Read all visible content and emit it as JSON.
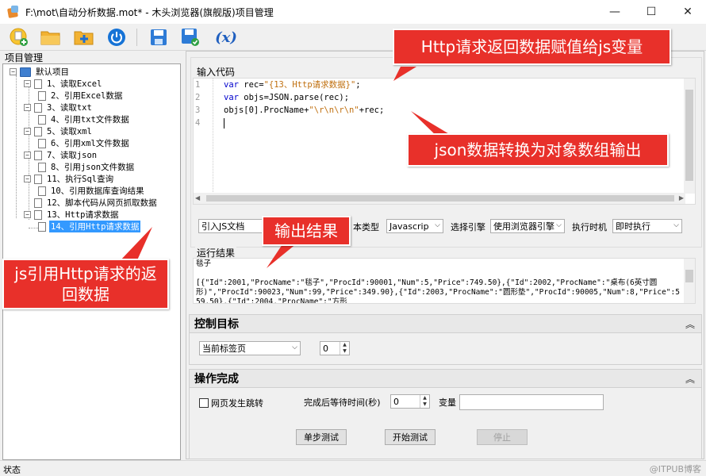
{
  "window": {
    "title": "F:\\mot\\自动分析数据.mot* - 木头浏览器(旗舰版)项目管理",
    "controls": [
      "—",
      "☐",
      "✕"
    ]
  },
  "toolbar": {
    "icons": [
      "new-project-icon",
      "open-folder-icon",
      "add-folder-icon",
      "power-icon",
      "save-icon",
      "save-as-icon",
      "variable-icon"
    ],
    "variable_label": "(x)"
  },
  "left_panel": {
    "label": "项目管理",
    "root": "默认项目",
    "items": [
      {
        "label": "1、读取Excel"
      },
      {
        "label": "2、引用Excel数据"
      },
      {
        "label": "3、读取txt"
      },
      {
        "label": "4、引用txt文件数据"
      },
      {
        "label": "5、读取xml"
      },
      {
        "label": "6、引用xml文件数据"
      },
      {
        "label": "7、读取json"
      },
      {
        "label": "8、引用json文件数据"
      },
      {
        "label": "11、执行Sql查询"
      },
      {
        "label": "10、引用数据库查询结果"
      },
      {
        "label": "12、脚本代码从网页抓取数据"
      },
      {
        "label": "13、Http请求数据"
      },
      {
        "label": "14、引用Http请求数据"
      }
    ]
  },
  "input_code": {
    "title": "输入代码",
    "line_numbers": [
      "1",
      "2",
      "3",
      "4"
    ],
    "lines": {
      "l1_kw": "var",
      "l1_a": " rec=",
      "l1_str": "\"{13、Http请求数据}\"",
      "l1_b": ";",
      "l2_kw": "var",
      "l2_a": " objs=JSON.parse(rec);",
      "l3_a": "objs[0].ProcName+",
      "l3_str": "\"\\r\\n\\r\\n\"",
      "l3_b": "+rec;"
    }
  },
  "options": {
    "import_js": "引入JS文档",
    "script_type_label": "本类型",
    "script_type_value": "Javascrip",
    "engine_label": "选择引擎",
    "engine_value": "使用浏览器引擎",
    "timing_label": "执行时机",
    "timing_value": "即时执行"
  },
  "run_result": {
    "title": "运行结果",
    "text": "毯子\n\n[{\"Id\":2001,\"ProcName\":\"毯子\",\"ProcId\":90001,\"Num\":5,\"Price\":749.50},{\"Id\":2002,\"ProcName\":\"桌布(6英寸圆形)\",\"ProcId\":90023,\"Num\":99,\"Price\":349.90},{\"Id\":2003,\"ProcName\":\"圆形垫\",\"ProcId\":90005,\"Num\":8,\"Price\":559.50},{\"Id\":2004,\"ProcName\":\"方形"
  },
  "control_target": {
    "title": "控制目标",
    "select_value": "当前标签页",
    "spin_value": "0"
  },
  "operation_done": {
    "title": "操作完成",
    "page_jump_label": "网页发生跳转",
    "wait_label": "完成后等待时间(秒)",
    "wait_value": "0",
    "variable_label": "变量",
    "variable_value": ""
  },
  "buttons": {
    "step_test": "单步测试",
    "start_test": "开始测试",
    "stop": "停止"
  },
  "statusbar": {
    "text": "状态",
    "watermark": "@ITPUB博客"
  },
  "callouts": {
    "http_to_js": "Http请求返回数据赋值给js变量",
    "json_convert": "json数据转换为对象数组输出",
    "output_result": "输出结果",
    "js_ref_http": "js引用Http请求的返回数据"
  },
  "colors": {
    "callout": "#e8302a",
    "selection": "#3399ff",
    "keyword": "#0000cc",
    "string": "#c07010"
  }
}
